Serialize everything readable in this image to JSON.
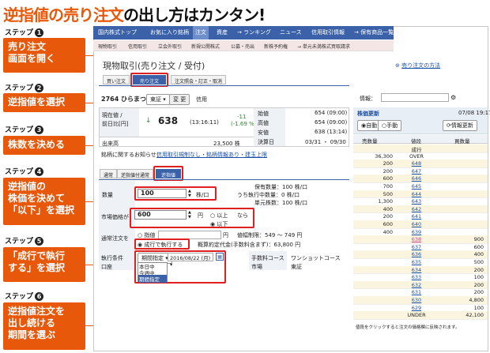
{
  "headline": {
    "orange": "逆指値の売り注文",
    "black": "の出し方はカンタン!"
  },
  "steps": [
    {
      "label": "ステップ",
      "num": "1",
      "desc": [
        "売り注文",
        "画面を開く"
      ]
    },
    {
      "label": "ステップ",
      "num": "2",
      "desc": [
        "逆指値を選択"
      ]
    },
    {
      "label": "ステップ",
      "num": "3",
      "desc": [
        "株数を決める"
      ]
    },
    {
      "label": "ステップ",
      "num": "4",
      "desc": [
        "逆指値の",
        "株価を決めて",
        "「以下」を選択"
      ]
    },
    {
      "label": "ステップ",
      "num": "5",
      "desc": [
        "「成行で執行",
        "する」を選択"
      ]
    },
    {
      "label": "ステップ",
      "num": "6",
      "desc": [
        "逆指値注文を",
        "出し続ける",
        "期間を選ぶ"
      ]
    }
  ],
  "nav": {
    "items": [
      "国内株式トップ",
      "お気に入り銘柄",
      "注文",
      "資産",
      "→ ランキング",
      "ニュース",
      "信用取引情報",
      "→ 保有商品一覧"
    ]
  },
  "subnav": {
    "items": [
      "現物取引",
      "信用取引",
      "立会外取引",
      "新規公開株式",
      "公募・売出",
      "新株予約権",
      "→ 単元未満株式買取請求"
    ]
  },
  "page": {
    "title": "現物取引(売り注文 / 受付)",
    "help_link": "売り注文の方法"
  },
  "order_tabs": [
    "買い注文",
    "売り注文",
    "注文照会・訂正・取消"
  ],
  "stock": {
    "code_name": "2764 ひらまつ",
    "market": "東証",
    "change_btn": "変 更",
    "credit": "信用"
  },
  "quote": {
    "label1": "現在値 /",
    "label2": "前日比[円]",
    "price": "638",
    "time": "(13:16:11)",
    "diff": "-11",
    "pct": "(-1.69 %)",
    "volume_label": "出来高",
    "volume": "23,500 株",
    "open_label": "始値",
    "open": "654 (09:00)",
    "high_label": "高値",
    "high": "654 (09:00)",
    "low_label": "安値",
    "low": "638 (13:14)",
    "settle_label": "決算日",
    "settle": "03/31 ・ 09/30"
  },
  "notice": {
    "label": "銘柄に関するお知らせ：",
    "link": "信用取引規制なし・銘柄情報あり・建玉上限"
  },
  "type_tabs": [
    "通常",
    "逆指値付通常",
    "逆指値"
  ],
  "qty": {
    "label": "数量",
    "value": "100",
    "unit": "株/口",
    "held": "保有数量：100 株/口",
    "pending": "うち執行中数量：0 株/口",
    "unit_shares": "単元株数：100 株/口"
  },
  "trigger": {
    "label": "市場価格が",
    "value": "600",
    "unit": "円",
    "opt1": "以上",
    "suffix": "なら",
    "opt2": "以下"
  },
  "exec": {
    "label": "通常注文を",
    "opt1": "指値",
    "unit": "円",
    "range": "値幅制限：549 〜 749 円",
    "opt2": "成行で執行する",
    "estimate": "概算約定代金(手数料含まず)：63,800 円"
  },
  "conditions": {
    "label": "執行条件",
    "period": "期間指定",
    "date": "2016/08/22 (月)",
    "fee_label": "手数料コース",
    "fee": "ワンショットコース",
    "account_label": "口座",
    "market_label": "市場",
    "market": "東証",
    "dropdown": [
      "本日中",
      "今週中",
      "期間指定"
    ]
  },
  "board": {
    "info_label": "情報：",
    "title": "株価更新",
    "date": "07/08 19:17",
    "auto": "自動",
    "manual": "手動",
    "update": "情報更新",
    "headers": [
      "売数量",
      "値段",
      "買数量"
    ],
    "top": [
      [
        "",
        "成行",
        ""
      ],
      [
        "36,300",
        "OVER",
        ""
      ]
    ],
    "rows": [
      [
        "200",
        "648",
        ""
      ],
      [
        "200",
        "647",
        ""
      ],
      [
        "600",
        "646",
        ""
      ],
      [
        "700",
        "645",
        ""
      ],
      [
        "500",
        "644",
        ""
      ],
      [
        "1,300",
        "643",
        ""
      ],
      [
        "400",
        "642",
        ""
      ],
      [
        "200",
        "641",
        ""
      ],
      [
        "600",
        "640",
        ""
      ],
      [
        "400",
        "639",
        ""
      ],
      [
        "",
        "638",
        "900"
      ],
      [
        "",
        "637",
        "600"
      ],
      [
        "",
        "636",
        "400"
      ],
      [
        "",
        "635",
        "500"
      ],
      [
        "",
        "634",
        "200"
      ],
      [
        "",
        "633",
        "100"
      ],
      [
        "",
        "632",
        "200"
      ],
      [
        "",
        "631",
        "200"
      ],
      [
        "",
        "630",
        "4,800"
      ],
      [
        "",
        "629",
        "100"
      ]
    ],
    "under": [
      "",
      "UNDER",
      "42,100"
    ],
    "note": "値段をクリックすると注文の価格欄に反映されます。"
  },
  "colors": {
    "orange": "#e8580a",
    "nav": "#3b62a8",
    "red": "#e02020"
  }
}
